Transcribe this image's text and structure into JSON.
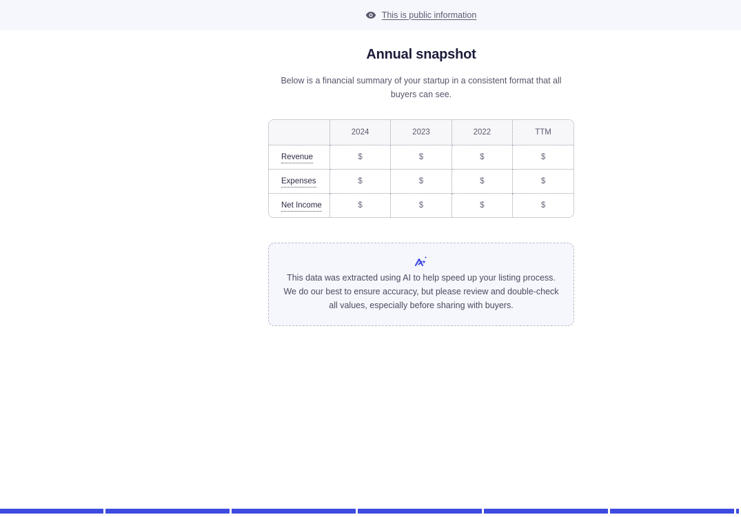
{
  "banner": {
    "icon": "eye-icon",
    "link_text": "This is public information"
  },
  "header": {
    "title": "Annual snapshot",
    "subtitle": "Below is a financial summary of your startup in a consistent format that all buyers can see."
  },
  "table": {
    "columns": [
      "",
      "2024",
      "2023",
      "2022",
      "TTM"
    ],
    "rows": [
      {
        "label": "Revenue",
        "values": [
          "$",
          "$",
          "$",
          "$"
        ]
      },
      {
        "label": "Expenses",
        "values": [
          "$",
          "$",
          "$",
          "$"
        ]
      },
      {
        "label": "Net Income",
        "values": [
          "$",
          "$",
          "$",
          "$"
        ]
      }
    ]
  },
  "notice": {
    "icon": "ai-sparkle-icon",
    "text": "This data was extracted using AI to help speed up your listing process. We do our best to ensure accuracy, but please review and double-check all values, especially before sharing with buyers."
  },
  "colors": {
    "accent": "#3d4be0",
    "banner_bg": "#f6f7fd",
    "title": "#1c1c3a"
  }
}
